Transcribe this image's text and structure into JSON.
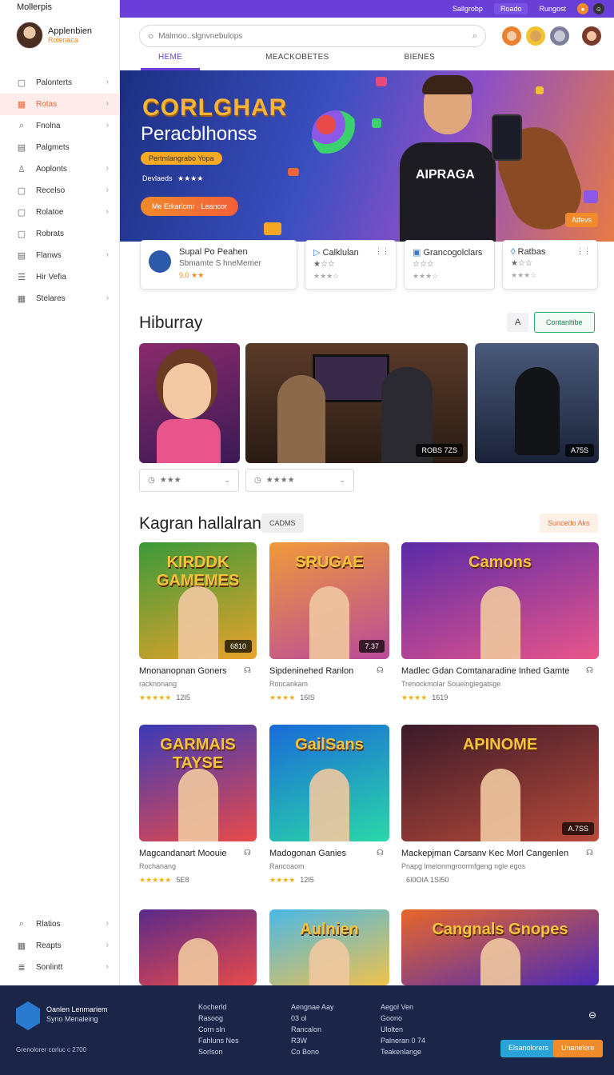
{
  "app": {
    "title": "Mollerpis"
  },
  "profile": {
    "name": "Applenbien",
    "sub": "Rolenaca"
  },
  "sidebar": {
    "items": [
      {
        "label": "Palonterts",
        "icon": "box-icon",
        "chevron": true,
        "active": false
      },
      {
        "label": "Rotas",
        "icon": "grid-icon",
        "chevron": true,
        "active": true
      },
      {
        "label": "Fnolna",
        "icon": "search-icon",
        "chevron": true,
        "active": false
      },
      {
        "label": "Palgmets",
        "icon": "doc-icon",
        "chevron": false,
        "active": false
      },
      {
        "label": "Aoplonts",
        "icon": "user-icon",
        "chevron": true,
        "active": false
      },
      {
        "label": "Recelso",
        "icon": "box-icon",
        "chevron": true,
        "active": false
      },
      {
        "label": "Rolatoe",
        "icon": "box-icon",
        "chevron": true,
        "active": false
      },
      {
        "label": "Robrats",
        "icon": "box-icon",
        "chevron": false,
        "active": false
      },
      {
        "label": "Flanws",
        "icon": "doc-icon",
        "chevron": true,
        "active": false
      },
      {
        "label": "Hir Vefia",
        "icon": "menu-icon",
        "chevron": false,
        "active": false
      },
      {
        "label": "Stelares",
        "icon": "grid-icon",
        "chevron": true,
        "active": false
      }
    ],
    "bottom_items": [
      {
        "label": "Rlatios",
        "icon": "search-icon"
      },
      {
        "label": "Reapts",
        "icon": "grid-icon"
      },
      {
        "label": "Sonlintt",
        "icon": "list-icon"
      }
    ]
  },
  "topbar": {
    "btn1": "Sallgrobp",
    "btn2": "Roado",
    "btn3": "Rungost"
  },
  "search": {
    "placeholder": "Malmoo..slgnvnebulops"
  },
  "tabs": [
    "HEME",
    "MEACKOBETES",
    "BIENES"
  ],
  "hero": {
    "title": "CORLGHAR",
    "subtitle": "Peracblhonss",
    "pill": "Pertmlangrabo Yopa",
    "rating_label": "Devlaeds",
    "rating_stars": "★★★★",
    "cta": "Me Erkarlcmr · Leancor",
    "badge": "Atfevs",
    "shirt_text": "AIPRAGA"
  },
  "features": [
    {
      "title": "Supal Po Peahen",
      "sub": "Sbmamte S hneMemer",
      "stars": "9.0 ★★"
    },
    {
      "title": "Calklulan",
      "sub": "★☆☆",
      "stars": "★★★☆"
    },
    {
      "title": "Grancogolclars",
      "sub": "☆☆☆",
      "stars": "★★★☆"
    },
    {
      "title": "Ratbas",
      "sub": "★☆☆",
      "stars": "★★★☆"
    }
  ],
  "section1": {
    "title": "Hiburray",
    "chip_a": "A",
    "chip_b": "Contanltibe",
    "badges": [
      "ROBS 7ZS",
      "A75S"
    ],
    "selects": [
      "★★★",
      "★★★★"
    ]
  },
  "section2": {
    "title": "Kagran hallalran",
    "chip": "CADMS",
    "chip_right": "Suncedo Aks",
    "cards": [
      {
        "title": "Mnonanopnan Goners",
        "sub": "racknonang",
        "rating": "★★★★★",
        "count": "12I5",
        "badge": "6810",
        "art": "KIRDDK GAMEMES"
      },
      {
        "title": "Sipdeninehed Ranlon",
        "sub": "Roncankam",
        "rating": "★★★★",
        "count": "16IS",
        "badge": "7.37",
        "art": "SRUGAE"
      },
      {
        "title": "Madlec Gdan Comtanaradine Inhed Gamte",
        "sub": "Trenockmolar Soueinglegatsge",
        "rating": "★★★★",
        "count": "1619",
        "badge": "",
        "art": "Camons"
      },
      {
        "title": "Magcandanart Moouie",
        "sub": "Rochanang",
        "rating": "★★★★★",
        "count": "5E8",
        "badge": "",
        "art": "GARMAIS TAYSE"
      },
      {
        "title": "Madogonan Ganies",
        "sub": "Rancoaom",
        "rating": "★★★★",
        "count": "12I5",
        "badge": "",
        "art": "GailSans"
      },
      {
        "title": "Mackepjman Carsanv Kec Morl Cangenlen",
        "sub": "Pnapg lmelonmgroormfgeng ngle egos",
        "rating": "",
        "count": "6I0OIA 1SI50",
        "badge": "A.7SS",
        "art": "APINOME"
      },
      {
        "title": "",
        "sub": "",
        "rating": "",
        "count": "",
        "badge": "",
        "art": ""
      },
      {
        "title": "",
        "sub": "",
        "rating": "",
        "count": "",
        "badge": "",
        "art": "Aulnien"
      },
      {
        "title": "",
        "sub": "",
        "rating": "",
        "count": "",
        "badge": "",
        "art": "Cangnals Gnopes"
      }
    ]
  },
  "footer": {
    "brand": "Oanlen Lenmariem",
    "brand_sub": "Syno Menaleing",
    "copyright": "Grenolorer corluc c 2700",
    "col1": [
      "Kocherld",
      "Rasoog",
      "Corn sln",
      "Fahluns Nes",
      "Sorlson"
    ],
    "col2": [
      "Aengnae Aay",
      "03 ol",
      "Rancalon",
      "R3W",
      "Co Bono"
    ],
    "col3": [
      "Aegol Ven",
      "Goono",
      "Ulolten",
      "Palneran 0 74",
      "Teakenlange"
    ],
    "btn_primary": "Elsanolorers",
    "btn_secondary": "Unanelere",
    "ext_icon": "external-icon"
  },
  "colors": {
    "accent": "#6a3fd8",
    "orange": "#f08a2a",
    "footer": "#1b2547"
  }
}
